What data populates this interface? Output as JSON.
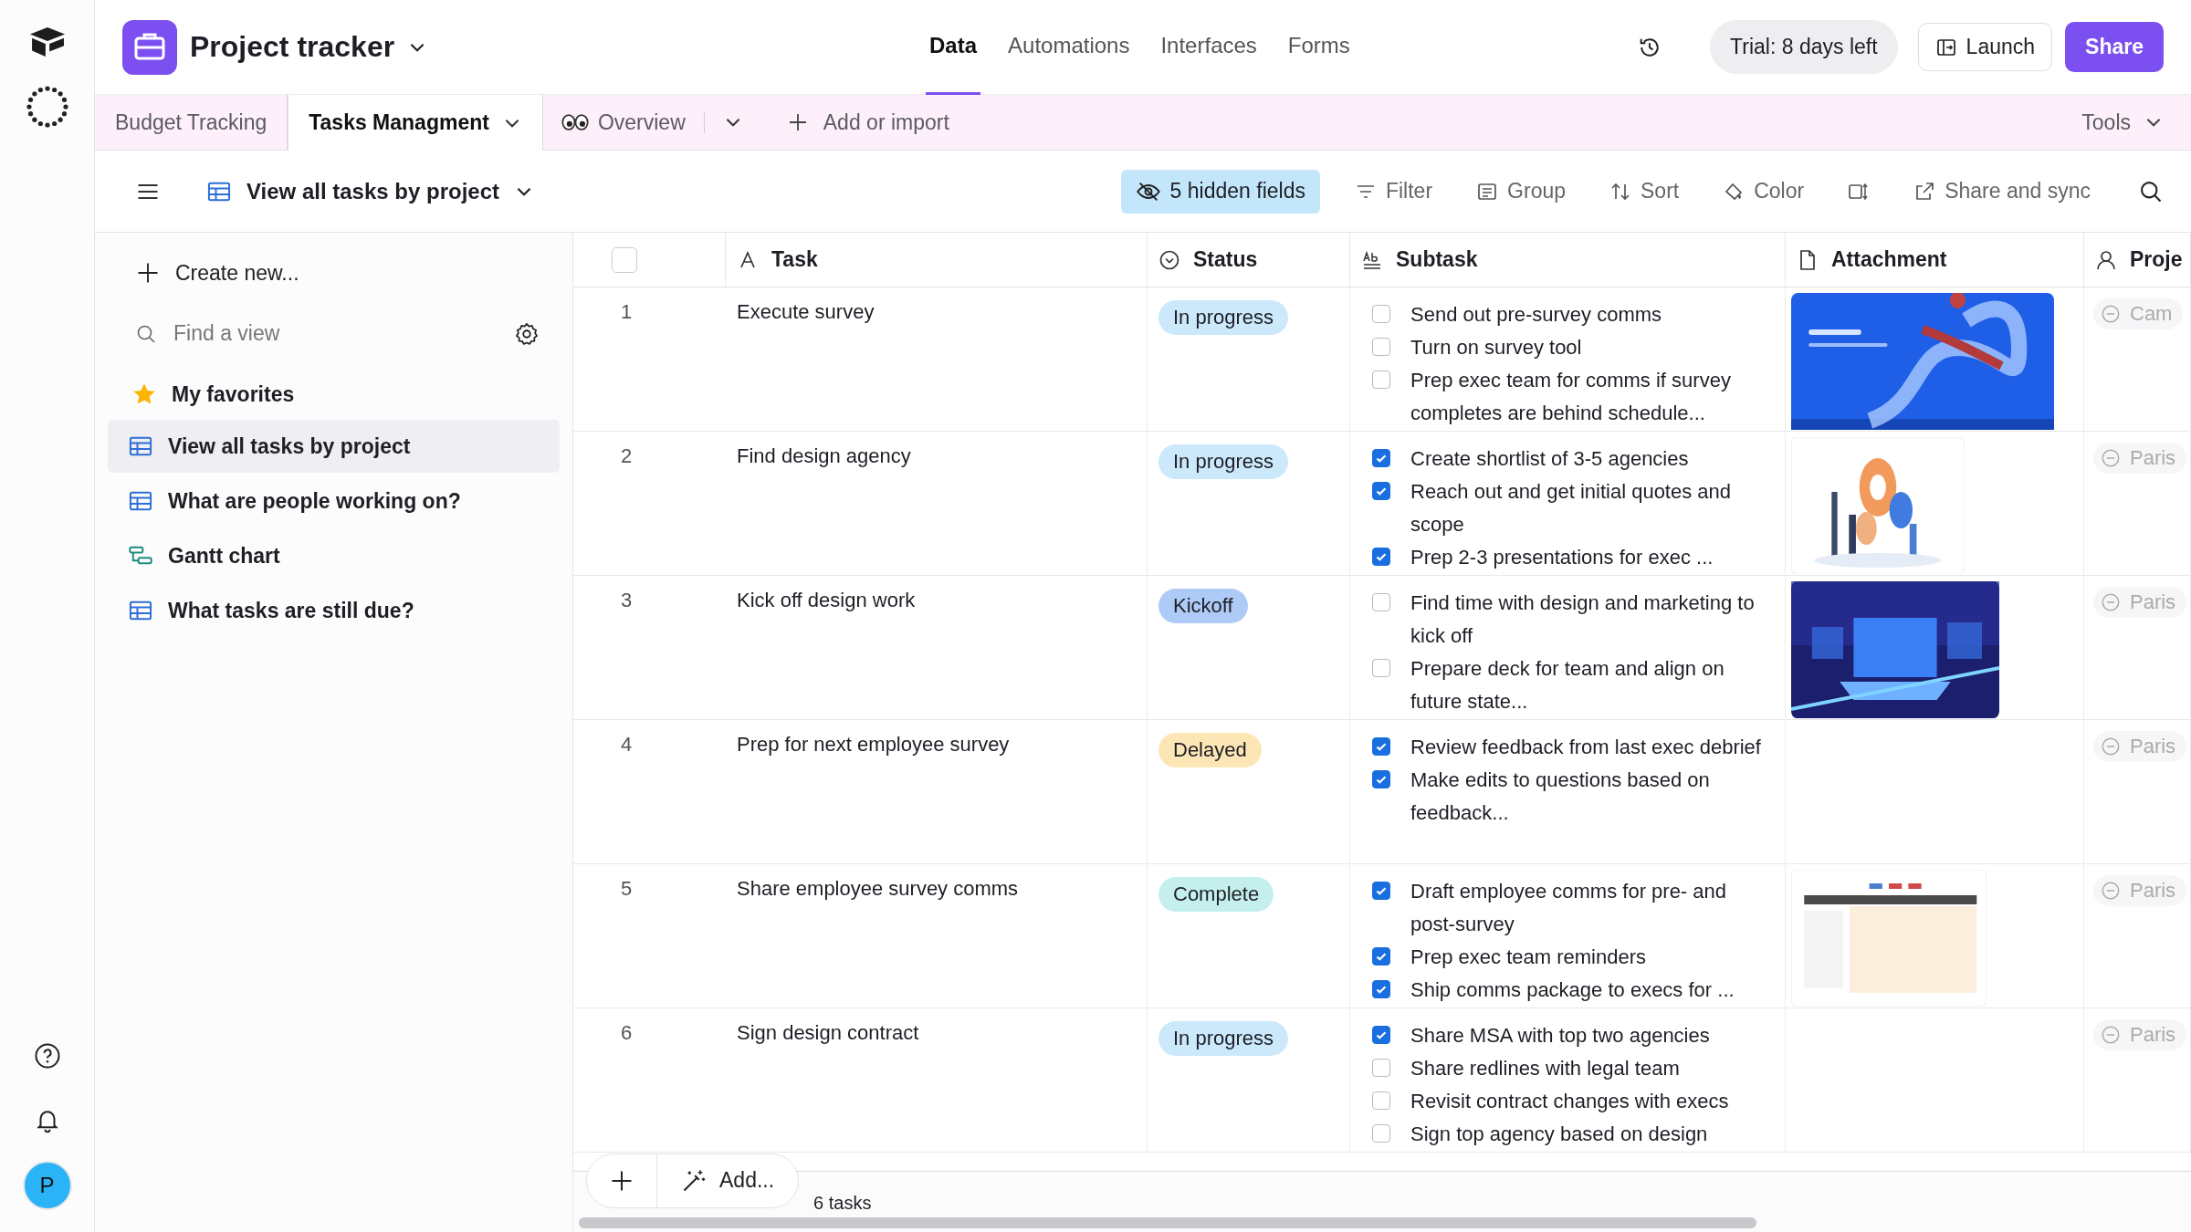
{
  "rail": {
    "avatar": "P"
  },
  "header": {
    "title": "Project tracker",
    "nav": [
      {
        "label": "Data",
        "selected": true
      },
      {
        "label": "Automations",
        "selected": false
      },
      {
        "label": "Interfaces",
        "selected": false
      },
      {
        "label": "Forms",
        "selected": false
      }
    ],
    "trial": "Trial: 8 days left",
    "launch": "Launch",
    "share": "Share"
  },
  "tables_bar": {
    "tabs": [
      {
        "label": "Budget Tracking",
        "selected": false
      },
      {
        "label": "Tasks Managment",
        "selected": true
      }
    ],
    "overview": "Overview",
    "add": "Add or import",
    "tools": "Tools"
  },
  "view_bar": {
    "view_name": "View all tasks by project",
    "hidden_fields": "5 hidden fields",
    "actions": [
      {
        "kind": "filter",
        "label": "Filter"
      },
      {
        "kind": "group",
        "label": "Group"
      },
      {
        "kind": "sort",
        "label": "Sort"
      },
      {
        "kind": "color",
        "label": "Color"
      },
      {
        "kind": "row-height"
      },
      {
        "kind": "share",
        "label": "Share and sync"
      }
    ]
  },
  "sidebar": {
    "create": "Create new...",
    "search": {
      "placeholder": "Find a view"
    },
    "favorites": "My favorites",
    "views": [
      {
        "label": "View all tasks by project",
        "kind": "grid",
        "selected": true
      },
      {
        "label": "What are people working on?",
        "kind": "grid",
        "selected": false
      },
      {
        "label": "Gantt chart",
        "kind": "gantt",
        "selected": false
      },
      {
        "label": "What tasks are still due?",
        "kind": "grid",
        "selected": false
      }
    ]
  },
  "table": {
    "select_all": {
      "checked": false
    },
    "columns": [
      {
        "label": "Task",
        "kind": "text"
      },
      {
        "label": "Status",
        "kind": "select"
      },
      {
        "label": "Subtask",
        "kind": "longtext"
      },
      {
        "label": "Attachment",
        "kind": "file"
      },
      {
        "label": "Proje",
        "kind": "person"
      }
    ],
    "rows": [
      {
        "number": "1",
        "task": "Execute survey",
        "status": {
          "label": "In progress",
          "color": "#cbe9fb"
        },
        "subtasks": [
          {
            "text": "Send out pre-survey comms",
            "checked": false
          },
          {
            "text": "Turn on survey tool",
            "checked": false
          },
          {
            "text": "Prep exec team for comms if survey completes are behind schedule...",
            "checked": false
          }
        ],
        "attachment": {
          "kind": "picture"
        },
        "project": "Cam"
      },
      {
        "number": "2",
        "task": "Find design agency",
        "status": {
          "label": "In progress",
          "color": "#cbe9fb"
        },
        "subtasks": [
          {
            "text": "Create shortlist of 3-5 agencies",
            "checked": true
          },
          {
            "text": "Reach out and get initial quotes and scope",
            "checked": true
          },
          {
            "text": "Prep 2-3 presentations for exec ...",
            "checked": true
          }
        ],
        "attachment": {
          "kind": "picture"
        },
        "project": "Paris"
      },
      {
        "number": "3",
        "task": "Kick off design work",
        "status": {
          "label": "Kickoff",
          "color": "#aecaf6"
        },
        "subtasks": [
          {
            "text": "Find time with design and marketing to kick off",
            "checked": false
          },
          {
            "text": "Prepare deck for team and align on future state...",
            "checked": false
          }
        ],
        "attachment": {
          "kind": "picture"
        },
        "project": "Paris"
      },
      {
        "number": "4",
        "task": "Prep for next employee survey",
        "status": {
          "label": "Delayed",
          "color": "#fde6b5"
        },
        "subtasks": [
          {
            "text": "Review feedback from last exec debrief",
            "checked": true
          },
          {
            "text": "Make edits to questions based on feedback...",
            "checked": true
          }
        ],
        "project": "Paris"
      },
      {
        "number": "5",
        "task": "Share employee survey comms",
        "status": {
          "label": "Complete",
          "color": "#c4efec"
        },
        "subtasks": [
          {
            "text": "Draft employee comms for pre- and post-survey",
            "checked": true
          },
          {
            "text": "Prep exec team reminders",
            "checked": true
          },
          {
            "text": "Ship comms package to execs for ...",
            "checked": true
          }
        ],
        "attachment": {
          "kind": "picture"
        },
        "project": "Paris"
      },
      {
        "number": "6",
        "task": "Sign design contract",
        "status": {
          "label": "In progress",
          "color": "#cbe9fb"
        },
        "subtasks": [
          {
            "text": "Share MSA with top two agencies",
            "checked": true
          },
          {
            "text": "Share redlines with legal team",
            "checked": false
          },
          {
            "text": "Revisit contract changes with execs",
            "checked": false
          },
          {
            "text": "Sign top agency based on design",
            "checked": false
          }
        ],
        "project": "Paris"
      }
    ],
    "footer": {
      "add": "Add...",
      "count": "6 tasks"
    }
  }
}
